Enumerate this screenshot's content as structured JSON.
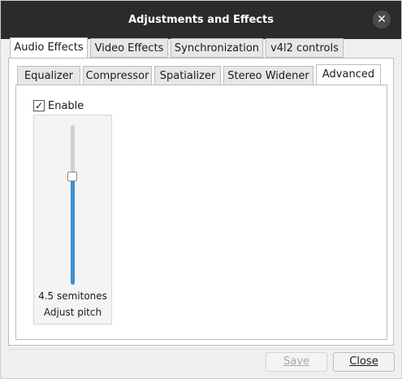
{
  "window": {
    "title": "Adjustments and Effects"
  },
  "outer_tabs": [
    "Audio Effects",
    "Video Effects",
    "Synchronization",
    "v4l2 controls"
  ],
  "inner_tabs": [
    "Equalizer",
    "Compressor",
    "Spatializer",
    "Stereo Widener",
    "Advanced"
  ],
  "advanced": {
    "enable_label": "Enable",
    "enable_checked": "✓",
    "pitch_value": "4.5 semitones",
    "pitch_label": "Adjust pitch",
    "pitch_fraction": 0.68
  },
  "buttons": {
    "save_label": "Save",
    "close_label": "Close"
  },
  "colors": {
    "accent": "#3d8fd1",
    "titlebar": "#2b2b2b"
  }
}
